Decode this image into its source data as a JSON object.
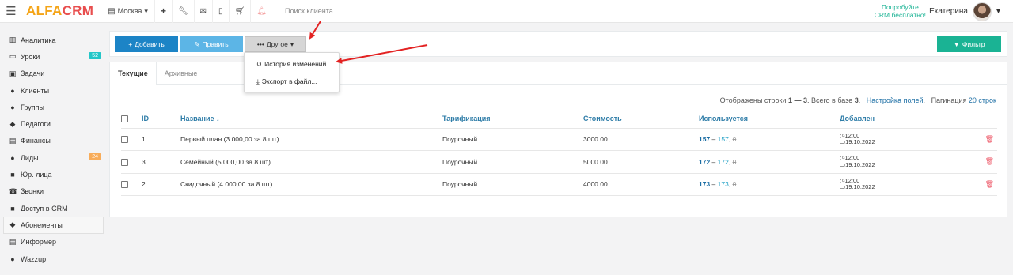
{
  "header": {
    "logo_alfa": "ALFA",
    "logo_crm": "CRM",
    "city": "Москва",
    "search_placeholder": "Поиск клиента",
    "promo_line1": "Попробуйте",
    "promo_line2": "CRM бесплатно!",
    "user_name": "Екатерина"
  },
  "sidebar": {
    "items": [
      {
        "label": "Аналитика",
        "icon": "columns-icon"
      },
      {
        "label": "Уроки",
        "icon": "calendar-icon",
        "badge": "52"
      },
      {
        "label": "Задачи",
        "icon": "tasks-icon"
      },
      {
        "label": "Клиенты",
        "icon": "user-icon"
      },
      {
        "label": "Группы",
        "icon": "users-icon"
      },
      {
        "label": "Педагоги",
        "icon": "graduation-cap-icon"
      },
      {
        "label": "Финансы",
        "icon": "money-icon"
      },
      {
        "label": "Лиды",
        "icon": "user-plus-icon",
        "badge": "24"
      },
      {
        "label": "Юр. лица",
        "icon": "briefcase-icon"
      },
      {
        "label": "Звонки",
        "icon": "phone-icon"
      },
      {
        "label": "Доступ в CRM",
        "icon": "lock-icon"
      },
      {
        "label": "Абонементы",
        "icon": "tags-icon"
      },
      {
        "label": "Информер",
        "icon": "list-icon"
      },
      {
        "label": "Wazzup",
        "icon": "whatsapp-icon"
      }
    ]
  },
  "toolbar": {
    "add": "Добавить",
    "edit": "Править",
    "other": "Другое",
    "filter": "Фильтр"
  },
  "dropdown": {
    "history": "История изменений",
    "export": "Экспорт в файл..."
  },
  "tabs": [
    "Текущие",
    "Архивные"
  ],
  "summary": {
    "shown": "Отображены строки",
    "range": "1 — 3",
    "total_prefix": ". Всего в базе",
    "total": "3",
    "settings": "Настройка полей",
    "pagination_label": "Пагинация",
    "pagination_value": "20 строк"
  },
  "table": {
    "headers": [
      "ID",
      "Название ↓",
      "Тарификация",
      "Стоимость",
      "Используется",
      "Добавлен"
    ],
    "rows": [
      {
        "id": "1",
        "name": "Первый план (3 000,00 за 8 шт)",
        "tariff": "Поурочный",
        "cost": "3000.00",
        "used_a": "157",
        "used_b": "157",
        "used_c": "0",
        "time": "12:00",
        "date": "19.10.2022"
      },
      {
        "id": "3",
        "name": "Семейный (5 000,00 за 8 шт)",
        "tariff": "Поурочный",
        "cost": "5000.00",
        "used_a": "172",
        "used_b": "172",
        "used_c": "0",
        "time": "12:00",
        "date": "19.10.2022"
      },
      {
        "id": "2",
        "name": "Скидочный (4 000,00 за 8 шт)",
        "tariff": "Поурочный",
        "cost": "4000.00",
        "used_a": "173",
        "used_b": "173",
        "used_c": "0",
        "time": "12:00",
        "date": "19.10.2022"
      }
    ]
  },
  "colors": {
    "accent_green": "#1ab394",
    "primary_blue": "#1c84c6",
    "annotation_red": "#e32222"
  }
}
